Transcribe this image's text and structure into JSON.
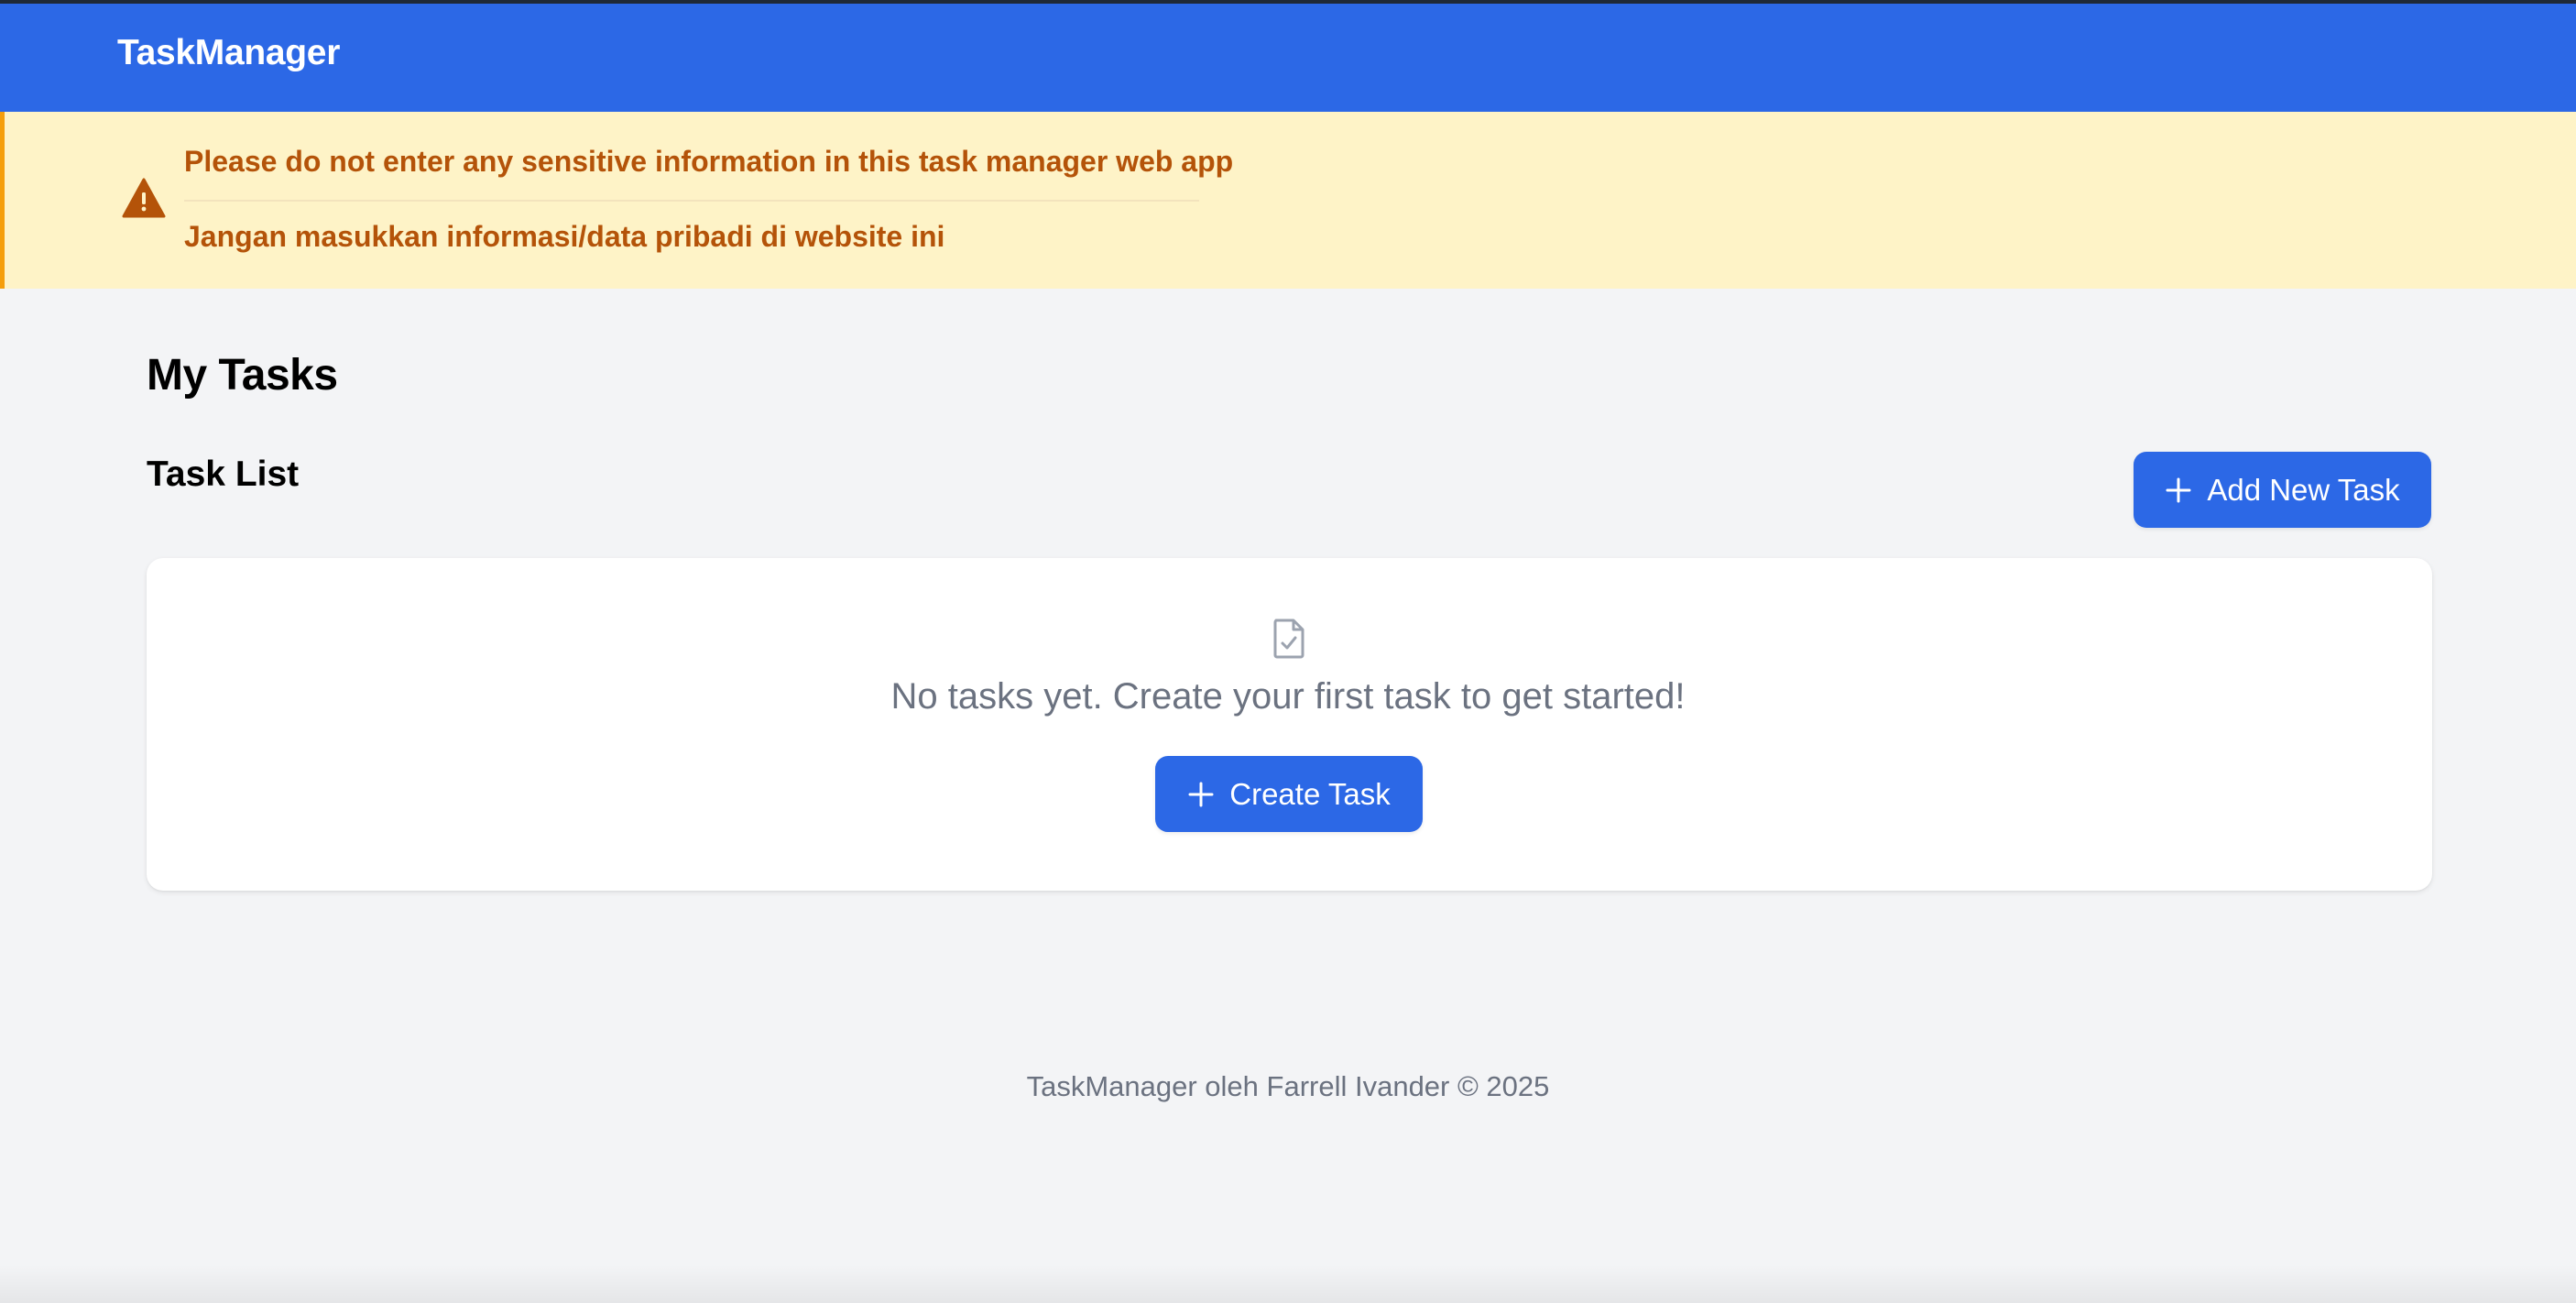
{
  "app": {
    "brand": "TaskManager"
  },
  "warning": {
    "icon": "warning-triangle-icon",
    "line1": "Please do not enter any sensitive information in this task manager web app",
    "line2": "Jangan masukkan informasi/data pribadi di website ini",
    "colors": {
      "background": "#fef3c7",
      "text": "#b45309",
      "border": "#f59e0b"
    }
  },
  "main": {
    "title": "My Tasks",
    "task_list_title": "Task List",
    "add_button_label": "Add New Task",
    "empty_state": {
      "icon": "document-check-icon",
      "message": "No tasks yet. Create your first task to get started!",
      "create_button_label": "Create Task"
    }
  },
  "footer": {
    "text": "TaskManager oleh Farrell Ivander © 2025"
  },
  "colors": {
    "accent": "#2c68e6",
    "page_background": "#f3f4f6"
  }
}
